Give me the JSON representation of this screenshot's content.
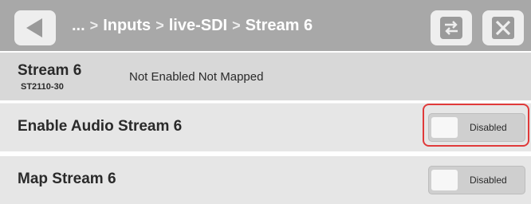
{
  "header": {
    "breadcrumb": {
      "ellipsis": "...",
      "items": [
        "Inputs",
        "live-SDI",
        "Stream 6"
      ],
      "separator": ">"
    },
    "icons": {
      "back": "back-arrow-icon",
      "swap": "swap-icon",
      "close": "close-icon"
    }
  },
  "stream": {
    "title": "Stream 6",
    "format": "ST2110-30",
    "status": "Not Enabled  Not Mapped"
  },
  "settings": [
    {
      "label": "Enable Audio Stream 6",
      "toggle_state": "Disabled",
      "highlighted": true
    },
    {
      "label": "Map Stream 6",
      "toggle_state": "Disabled",
      "highlighted": false
    }
  ],
  "colors": {
    "header_bg": "#a8a8a8",
    "highlight": "#e03a3a"
  }
}
